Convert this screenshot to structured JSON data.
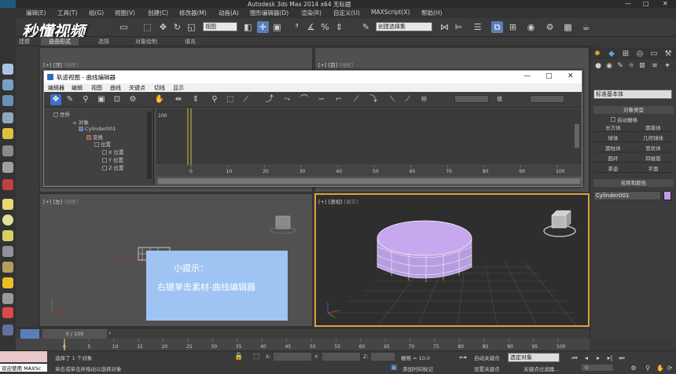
{
  "app": {
    "title": "Autodesk 3ds Max  2014 x64     无标题",
    "window_controls": [
      "—",
      "□",
      "✕"
    ]
  },
  "menubar": {
    "items": [
      "编辑(E)",
      "工具(T)",
      "组(G)",
      "视图(V)",
      "创建(C)",
      "修改器(M)",
      "动画(A)",
      "图形编辑器(D)",
      "渲染(R)",
      "自定义(U)",
      "MAXScript(X)",
      "帮助(H)"
    ]
  },
  "toolbar": {
    "ref_coord": "视图",
    "named_selection": "创建选择集"
  },
  "ribbon": {
    "tabs": [
      "建模",
      "自由形式",
      "选择",
      "对象绘制",
      "填充"
    ],
    "active": "自由形式"
  },
  "viewports": {
    "top": {
      "label": "[+] [顶]",
      "mode": "[线框]"
    },
    "front": {
      "label": "[+] [前]",
      "mode": "[线框]"
    },
    "left": {
      "label": "[+] [左]",
      "mode": "[线框]"
    },
    "perspective": {
      "label": "[+] [透视]",
      "mode": "[真实]"
    }
  },
  "curve_editor": {
    "title": "轨迹视图 - 曲线编辑器",
    "menu": [
      "编辑器",
      "编辑",
      "视图",
      "曲线",
      "关键点",
      "切线",
      "显示"
    ],
    "field_frame_label": "帧",
    "field_value_label": "值",
    "tree": [
      {
        "label": "世界",
        "depth": 0
      },
      {
        "label": "对象",
        "depth": 1
      },
      {
        "label": "Cylinder001",
        "depth": 2
      },
      {
        "label": "变换",
        "depth": 3
      },
      {
        "label": "位置",
        "depth": 4
      },
      {
        "label": "X 位置",
        "depth": 5
      },
      {
        "label": "Y 位置",
        "depth": 5
      },
      {
        "label": "Z 位置",
        "depth": 5
      }
    ],
    "y_label": "100",
    "ruler_ticks": [
      "0",
      "10",
      "20",
      "30",
      "40",
      "50",
      "60",
      "70",
      "80",
      "90",
      "100"
    ]
  },
  "tip": {
    "title": "小提示：",
    "body": "右键单击素材-曲线编辑器"
  },
  "right_panel": {
    "category": "标准基本体",
    "rollout_type": "对象类型",
    "autogrid": "自动栅格",
    "buttons": [
      "长方体",
      "圆锥体",
      "球体",
      "几何球体",
      "圆柱体",
      "管状体",
      "圆环",
      "四棱锥",
      "茶壶",
      "平面"
    ],
    "rollout_name": "名称和颜色",
    "object_name": "Cylinder001",
    "object_color": "#c49ae8"
  },
  "timeline": {
    "frame_display": "0 / 100",
    "ticks": [
      "0",
      "5",
      "10",
      "15",
      "20",
      "25",
      "30",
      "35",
      "40",
      "45",
      "50",
      "55",
      "60",
      "65",
      "70",
      "75",
      "80",
      "85",
      "90",
      "95",
      "100"
    ]
  },
  "status": {
    "welcome": "欢迎使用 MAXSc",
    "selected": "选择了 1 个对象",
    "prompt": "单击或单击并拖动以选择对象",
    "x_label": "X:",
    "y_label": "Y:",
    "z_label": "Z:",
    "grid": "栅格 = 10.0",
    "add_time_tag": "添加时间标记",
    "auto_key": "自动关键点",
    "set_key": "设置关键点",
    "selected_set": "选定对象",
    "key_filters": "关键点过滤器...",
    "frame_value": "0"
  },
  "colors": {
    "accent_blue": "#3d72c4",
    "tip_bg": "#9fc4f3",
    "cylinder": "#c6a8ee",
    "viewport_active": "#d8a23a"
  }
}
